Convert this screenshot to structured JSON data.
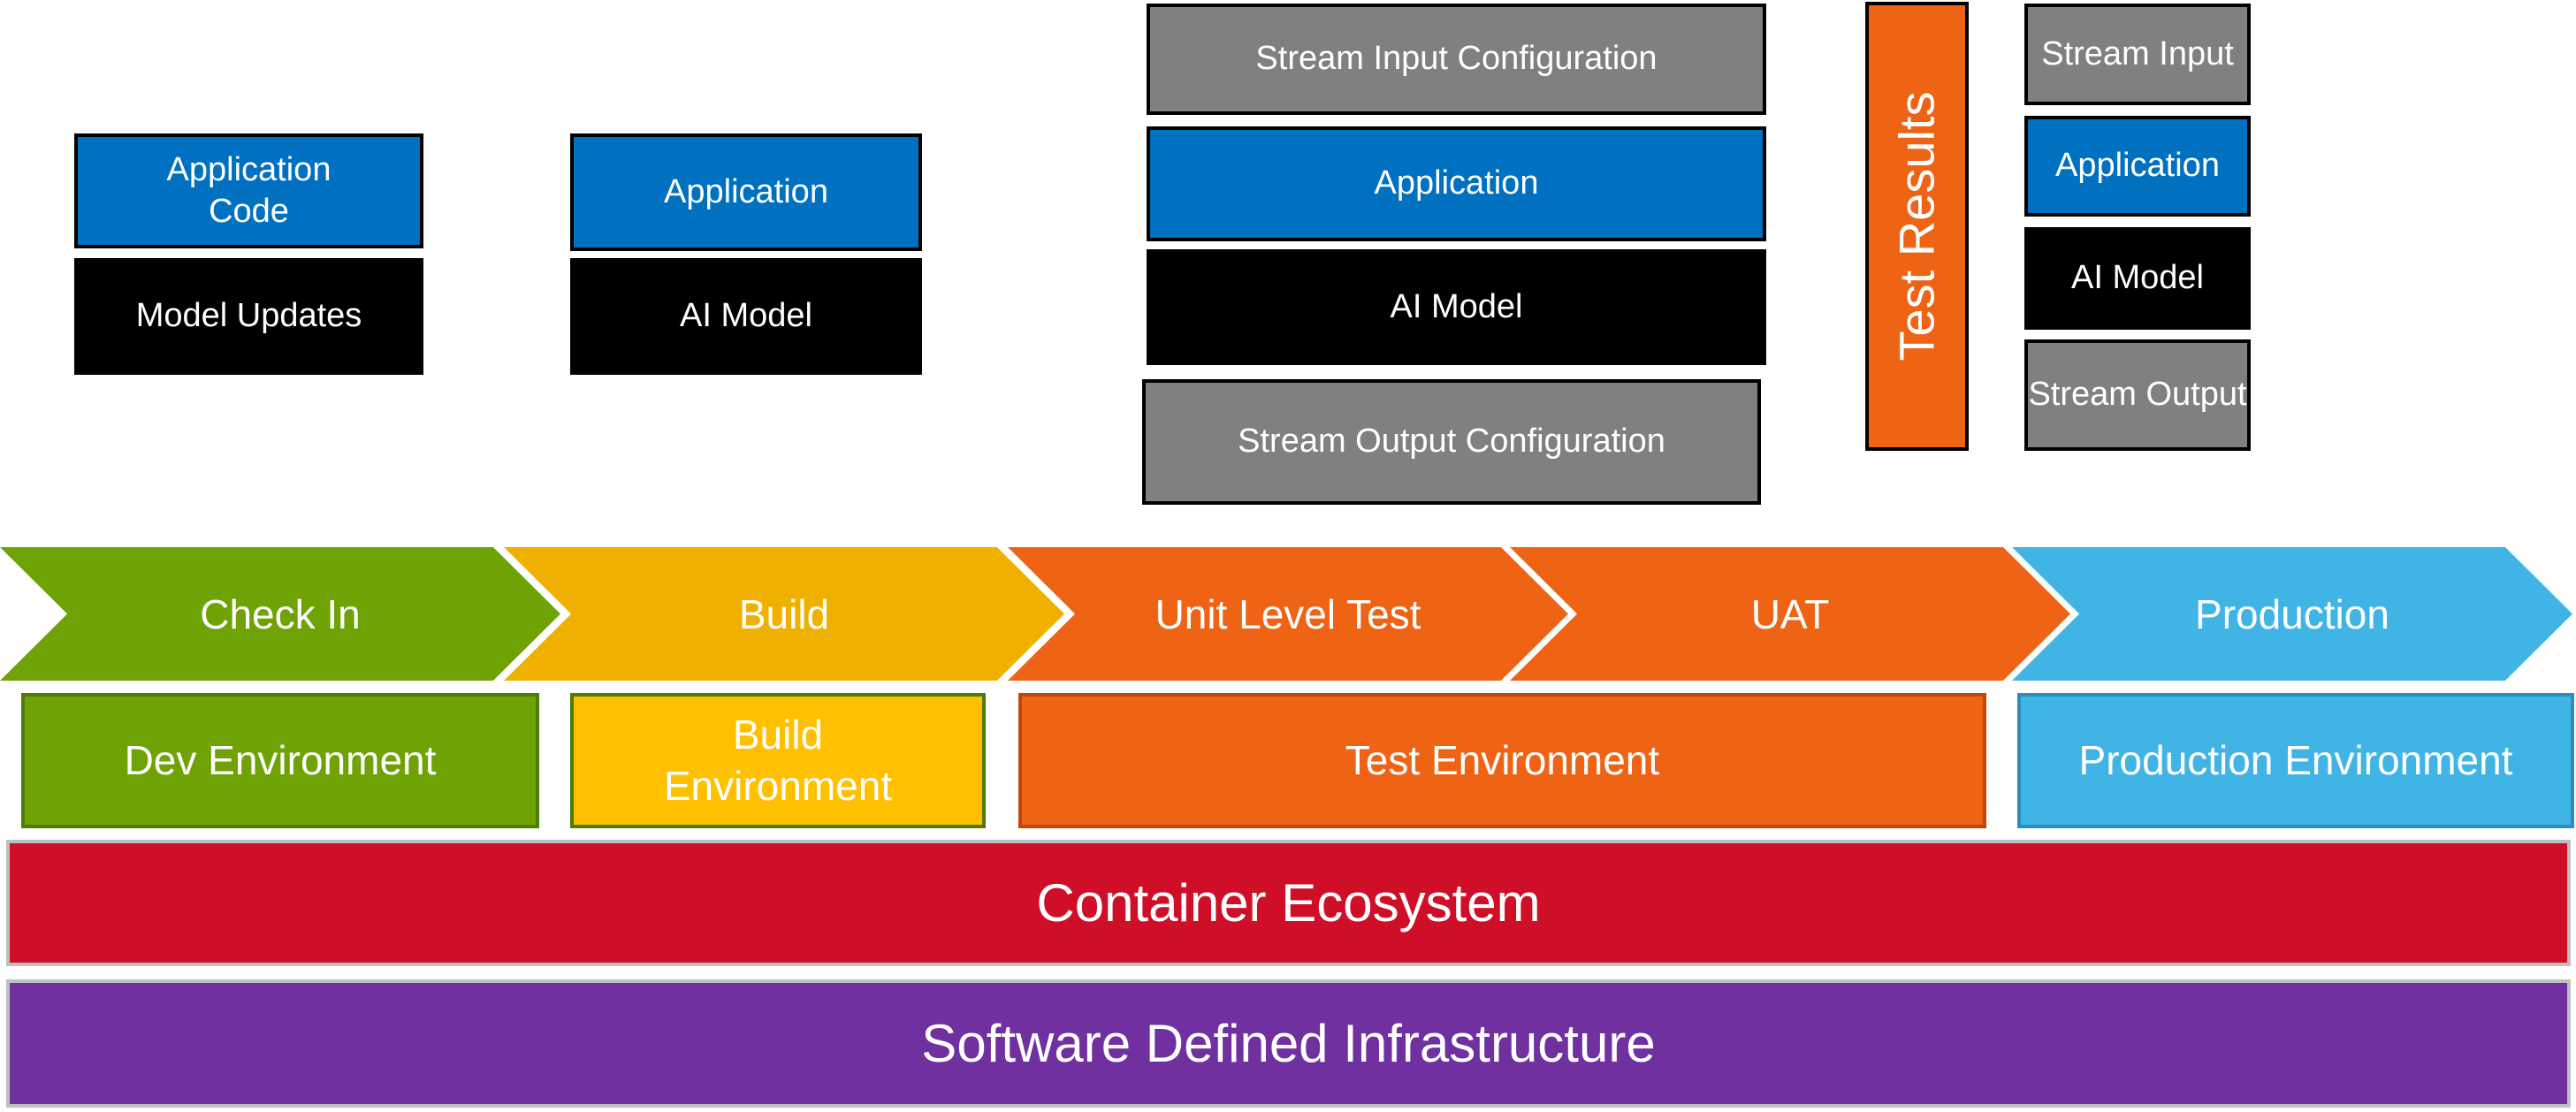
{
  "dev_stack": [
    "Application Code",
    "Model Updates"
  ],
  "build_stack": [
    "Application",
    "AI Model"
  ],
  "test_stack": [
    "Stream Input Configuration",
    "Application",
    "AI Model",
    "Stream Output Configuration"
  ],
  "test_results": "Test Results",
  "production_stack": [
    "Stream Input",
    "Application",
    "AI Model",
    "Stream Output"
  ],
  "pipeline": [
    "Check In",
    "Build",
    "Unit Level Test",
    "UAT",
    "Production"
  ],
  "environments": [
    "Dev Environment",
    "Build Environment",
    "Test Environment",
    "Production Environment"
  ],
  "container_layer": "Container Ecosystem",
  "infrastructure_layer": "Software Defined Infrastructure",
  "colors": {
    "check_in": "#6fa204",
    "build": "#f0b000",
    "test": "#ee6314",
    "production": "#41b4e6",
    "container": "#cf0f28",
    "infrastructure": "#7030a0",
    "application": "#0070c0",
    "config": "#808080",
    "model": "#000000"
  }
}
